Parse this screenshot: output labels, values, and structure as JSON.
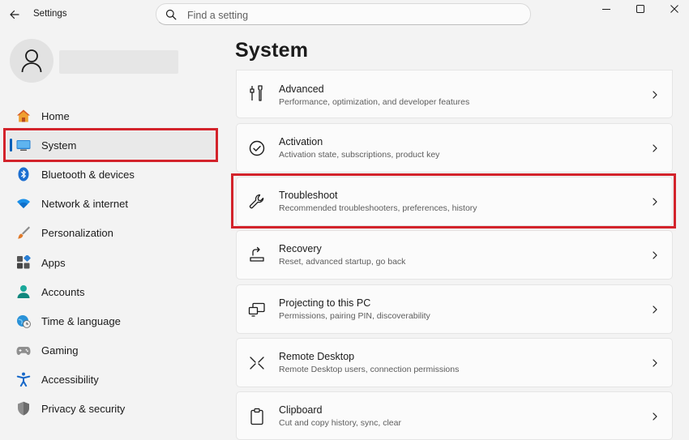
{
  "app": {
    "title": "Settings"
  },
  "search": {
    "placeholder": "Find a setting"
  },
  "sidebar": {
    "items": [
      {
        "label": "Home",
        "icon": "home-icon"
      },
      {
        "label": "System",
        "icon": "system-display-icon",
        "selected": true
      },
      {
        "label": "Bluetooth & devices",
        "icon": "bluetooth-icon"
      },
      {
        "label": "Network & internet",
        "icon": "wifi-icon"
      },
      {
        "label": "Personalization",
        "icon": "brush-icon"
      },
      {
        "label": "Apps",
        "icon": "apps-icon"
      },
      {
        "label": "Accounts",
        "icon": "accounts-icon"
      },
      {
        "label": "Time & language",
        "icon": "globe-clock-icon"
      },
      {
        "label": "Gaming",
        "icon": "gamepad-icon"
      },
      {
        "label": "Accessibility",
        "icon": "accessibility-icon"
      },
      {
        "label": "Privacy & security",
        "icon": "shield-icon"
      }
    ]
  },
  "main": {
    "title": "System",
    "cards": [
      {
        "title": "Advanced",
        "subtitle": "Performance, optimization, and developer features",
        "icon": "tools-icon"
      },
      {
        "title": "Activation",
        "subtitle": "Activation state, subscriptions, product key",
        "icon": "check-circle-icon"
      },
      {
        "title": "Troubleshoot",
        "subtitle": "Recommended troubleshooters, preferences, history",
        "icon": "wrench-icon"
      },
      {
        "title": "Recovery",
        "subtitle": "Reset, advanced startup, go back",
        "icon": "recovery-icon"
      },
      {
        "title": "Projecting to this PC",
        "subtitle": "Permissions, pairing PIN, discoverability",
        "icon": "projecting-icon"
      },
      {
        "title": "Remote Desktop",
        "subtitle": "Remote Desktop users, connection permissions",
        "icon": "remote-desktop-icon"
      },
      {
        "title": "Clipboard",
        "subtitle": "Cut and copy history, sync, clear",
        "icon": "clipboard-icon"
      }
    ]
  },
  "colors": {
    "accent": "#005fb8",
    "highlight_box": "#d3232b",
    "background": "#f3f3f3"
  }
}
